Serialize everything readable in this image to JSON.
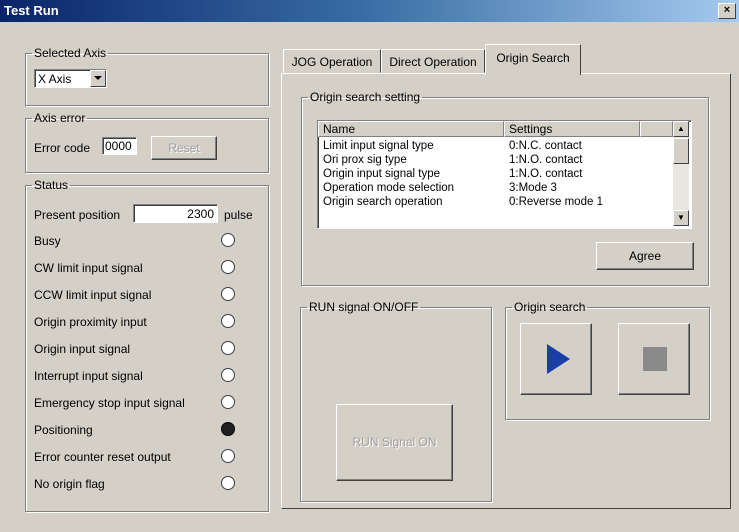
{
  "window": {
    "title": "Test Run",
    "close_label": "×"
  },
  "selected_axis": {
    "legend": "Selected Axis",
    "value": "X Axis"
  },
  "axis_error": {
    "legend": "Axis error",
    "code_label": "Error code",
    "code_value": "0000",
    "reset_label": "Reset"
  },
  "status": {
    "legend": "Status",
    "present_position_label": "Present position",
    "present_position_value": "2300",
    "unit": "pulse",
    "signals": [
      {
        "label": "Busy",
        "on": false
      },
      {
        "label": "CW limit input signal",
        "on": false
      },
      {
        "label": "CCW limit input signal",
        "on": false
      },
      {
        "label": "Origin proximity input",
        "on": false
      },
      {
        "label": "Origin input signal",
        "on": false
      },
      {
        "label": "Interrupt input signal",
        "on": false
      },
      {
        "label": "Emergency stop input signal",
        "on": false
      },
      {
        "label": "Positioning",
        "on": true
      },
      {
        "label": "Error counter reset output",
        "on": false
      },
      {
        "label": "No origin flag",
        "on": false
      }
    ]
  },
  "tabs": [
    {
      "label": "JOG Operation"
    },
    {
      "label": "Direct Operation"
    },
    {
      "label": "Origin Search"
    }
  ],
  "origin_search_setting": {
    "legend": "Origin search setting",
    "columns": [
      "Name",
      "Settings"
    ],
    "rows": [
      [
        "Limit input signal type",
        "0:N.C. contact"
      ],
      [
        "Ori prox sig type",
        "1:N.O. contact"
      ],
      [
        "Origin input signal type",
        "1:N.O. contact"
      ],
      [
        "Operation mode selection",
        "3:Mode 3"
      ],
      [
        "Origin search operation",
        "0:Reverse mode 1"
      ]
    ],
    "agree_label": "Agree"
  },
  "run_signal": {
    "legend": "RUN signal ON/OFF",
    "button_label": "RUN Signal ON"
  },
  "origin_search": {
    "legend": "Origin search",
    "start_icon": "play-icon",
    "stop_icon": "stop-icon"
  }
}
